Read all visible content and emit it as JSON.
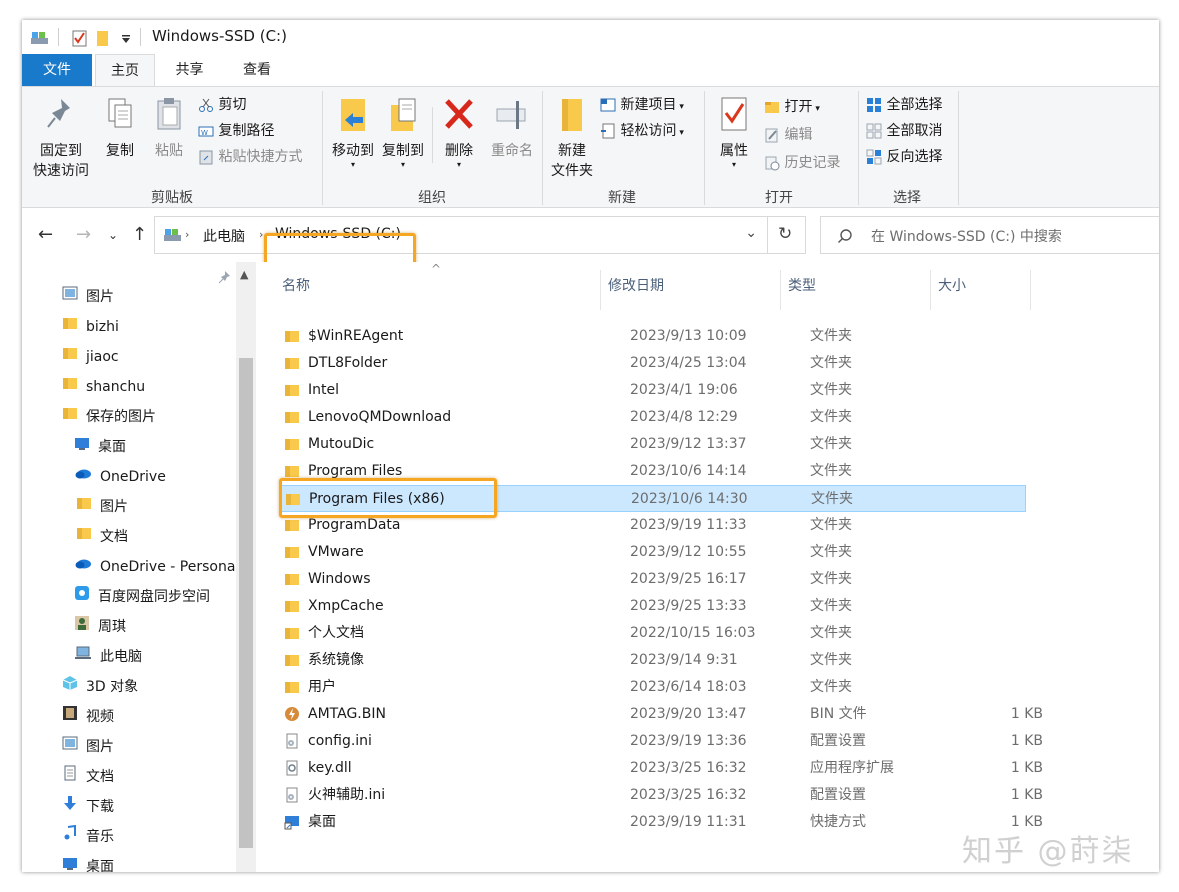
{
  "window": {
    "title": "Windows-SSD (C:)"
  },
  "tabs": {
    "file": "文件",
    "home": "主页",
    "share": "共享",
    "view": "查看"
  },
  "ribbon": {
    "clipboard": {
      "label": "剪贴板",
      "pin_line1": "固定到",
      "pin_line2": "快速访问",
      "copy": "复制",
      "paste": "粘贴",
      "cut": "剪切",
      "copy_path": "复制路径",
      "paste_shortcut": "粘贴快捷方式"
    },
    "organize": {
      "label": "组织",
      "move_to": "移动到",
      "copy_to": "复制到",
      "delete": "删除",
      "rename": "重命名"
    },
    "new": {
      "label": "新建",
      "new_folder_line1": "新建",
      "new_folder_line2": "文件夹",
      "new_item": "新建项目",
      "easy_access": "轻松访问"
    },
    "open": {
      "label": "打开",
      "properties": "属性",
      "open": "打开",
      "edit": "编辑",
      "history": "历史记录"
    },
    "select": {
      "label": "选择",
      "select_all": "全部选择",
      "select_none": "全部取消",
      "invert": "反向选择"
    }
  },
  "address": {
    "crumb_pc": "此电脑",
    "crumb_drive": "Windows-SSD (C:)",
    "search_placeholder": "在 Windows-SSD (C:) 中搜索"
  },
  "nav": [
    {
      "label": "图片",
      "icon": "pictures-icon",
      "indent": 1
    },
    {
      "label": "bizhi",
      "icon": "folder-icon",
      "indent": 1
    },
    {
      "label": "jiaoc",
      "icon": "folder-icon",
      "indent": 1
    },
    {
      "label": "shanchu",
      "icon": "folder-icon",
      "indent": 1
    },
    {
      "label": "保存的图片",
      "icon": "folder-icon",
      "indent": 1
    },
    {
      "label": "桌面",
      "icon": "desktop-icon",
      "indent": 0
    },
    {
      "label": "OneDrive",
      "icon": "cloud-icon",
      "indent": 0
    },
    {
      "label": "图片",
      "icon": "folder-icon",
      "indent": 2
    },
    {
      "label": "文档",
      "icon": "folder-icon",
      "indent": 2
    },
    {
      "label": "OneDrive - Personal",
      "icon": "cloud-icon",
      "indent": 0
    },
    {
      "label": "百度网盘同步空间",
      "icon": "baidu-icon",
      "indent": 0
    },
    {
      "label": "周琪",
      "icon": "user-icon",
      "indent": 0
    },
    {
      "label": "此电脑",
      "icon": "computer-icon",
      "indent": 0
    },
    {
      "label": "3D 对象",
      "icon": "3d-objects-icon",
      "indent": 1
    },
    {
      "label": "视频",
      "icon": "video-icon",
      "indent": 1
    },
    {
      "label": "图片",
      "icon": "pictures-icon",
      "indent": 1
    },
    {
      "label": "文档",
      "icon": "document-icon",
      "indent": 1
    },
    {
      "label": "下载",
      "icon": "download-icon",
      "indent": 1
    },
    {
      "label": "音乐",
      "icon": "music-icon",
      "indent": 1
    },
    {
      "label": "桌面",
      "icon": "desktop-icon",
      "indent": 1
    }
  ],
  "columns": {
    "name": "名称",
    "date": "修改日期",
    "type": "类型",
    "size": "大小"
  },
  "files": [
    {
      "name": "$WinREAgent",
      "date": "2023/9/13 10:09",
      "type": "文件夹",
      "size": "",
      "icon": "folder-icon"
    },
    {
      "name": "DTL8Folder",
      "date": "2023/4/25 13:04",
      "type": "文件夹",
      "size": "",
      "icon": "folder-icon"
    },
    {
      "name": "Intel",
      "date": "2023/4/1 19:06",
      "type": "文件夹",
      "size": "",
      "icon": "folder-icon"
    },
    {
      "name": "LenovoQMDownload",
      "date": "2023/4/8 12:29",
      "type": "文件夹",
      "size": "",
      "icon": "folder-icon"
    },
    {
      "name": "MutouDic",
      "date": "2023/9/12 13:37",
      "type": "文件夹",
      "size": "",
      "icon": "folder-icon"
    },
    {
      "name": "Program Files",
      "date": "2023/10/6 14:14",
      "type": "文件夹",
      "size": "",
      "icon": "folder-icon"
    },
    {
      "name": "Program Files (x86)",
      "date": "2023/10/6 14:30",
      "type": "文件夹",
      "size": "",
      "icon": "folder-icon",
      "selected": true
    },
    {
      "name": "ProgramData",
      "date": "2023/9/19 11:33",
      "type": "文件夹",
      "size": "",
      "icon": "folder-icon"
    },
    {
      "name": "VMware",
      "date": "2023/9/12 10:55",
      "type": "文件夹",
      "size": "",
      "icon": "folder-icon"
    },
    {
      "name": "Windows",
      "date": "2023/9/25 16:17",
      "type": "文件夹",
      "size": "",
      "icon": "folder-icon"
    },
    {
      "name": "XmpCache",
      "date": "2023/9/25 13:33",
      "type": "文件夹",
      "size": "",
      "icon": "folder-icon"
    },
    {
      "name": "个人文档",
      "date": "2022/10/15 16:03",
      "type": "文件夹",
      "size": "",
      "icon": "folder-icon"
    },
    {
      "name": "系统镜像",
      "date": "2023/9/14 9:31",
      "type": "文件夹",
      "size": "",
      "icon": "folder-icon"
    },
    {
      "name": "用户",
      "date": "2023/6/14 18:03",
      "type": "文件夹",
      "size": "",
      "icon": "folder-icon"
    },
    {
      "name": "AMTAG.BIN",
      "date": "2023/9/20 13:47",
      "type": "BIN 文件",
      "size": "1 KB",
      "icon": "bin-file-icon"
    },
    {
      "name": "config.ini",
      "date": "2023/9/19 13:36",
      "type": "配置设置",
      "size": "1 KB",
      "icon": "ini-file-icon"
    },
    {
      "name": "key.dll",
      "date": "2023/3/25 16:32",
      "type": "应用程序扩展",
      "size": "1 KB",
      "icon": "dll-file-icon"
    },
    {
      "name": "火神辅助.ini",
      "date": "2023/3/25 16:32",
      "type": "配置设置",
      "size": "1 KB",
      "icon": "ini-file-icon"
    },
    {
      "name": "桌面",
      "date": "2023/9/19 11:31",
      "type": "快捷方式",
      "size": "1 KB",
      "icon": "shortcut-icon"
    }
  ],
  "watermark": "知乎 @莳柒",
  "colors": {
    "accent": "#1979ca",
    "selection": "#cce8ff",
    "highlight": "#f5a623",
    "folder": "#f8c94a"
  }
}
